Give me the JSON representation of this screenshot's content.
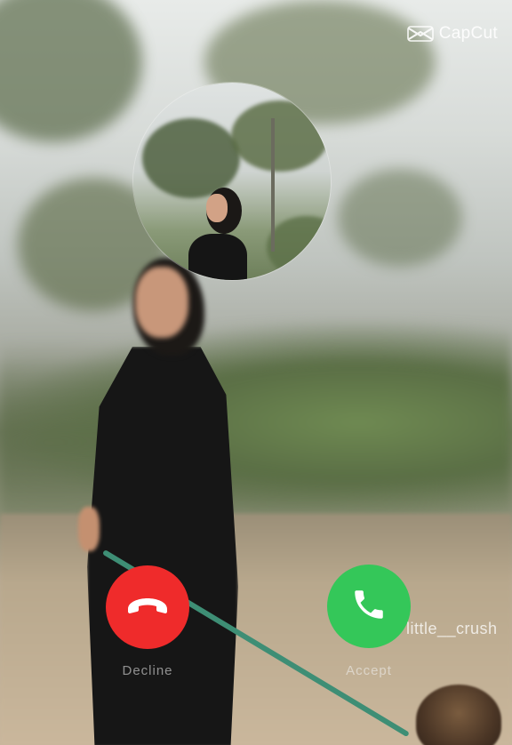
{
  "watermark": {
    "brand": "CapCut",
    "icon": "capcut-logo-icon"
  },
  "caller": {
    "handle": "little__crush",
    "avatar_icon": "caller-photo"
  },
  "actions": {
    "decline": {
      "label": "Decline",
      "icon": "phone-hangup-icon",
      "color": "#ef2b2b"
    },
    "accept": {
      "label": "Accept",
      "icon": "phone-icon",
      "color": "#34c759"
    }
  }
}
